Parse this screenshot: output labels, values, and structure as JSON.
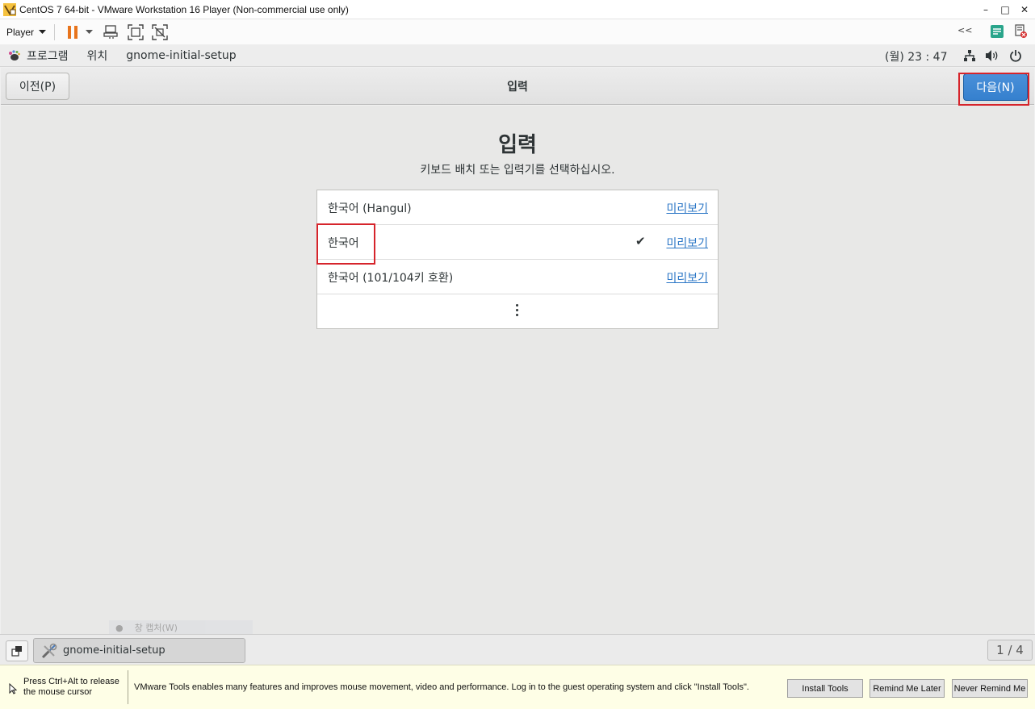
{
  "window": {
    "title": "CentOS 7 64-bit - VMware Workstation 16 Player (Non-commercial use only)",
    "minimize_glyph": "–",
    "maximize_glyph": "□",
    "close_glyph": "✕"
  },
  "vm_toolbar": {
    "player_label": "Player",
    "collapse_glyph": "<<"
  },
  "gnome_panel": {
    "applications": "프로그램",
    "places": "위치",
    "active_app": "gnome-initial-setup",
    "clock": "(월) 23 : 47"
  },
  "header": {
    "prev_label": "이전(P)",
    "title": "입력",
    "next_label": "다음(N)"
  },
  "main": {
    "heading": "입력",
    "subtitle": "키보드 배치 또는 입력기를 선택하십시오.",
    "layouts": [
      {
        "name": "한국어 (Hangul)",
        "selected": false,
        "preview": "미리보기"
      },
      {
        "name": "한국어",
        "selected": true,
        "check": "✔",
        "preview": "미리보기"
      },
      {
        "name": "한국어 (101/104키 호환)",
        "selected": false,
        "preview": "미리보기"
      }
    ],
    "ghost_text": "창 캡처(W)"
  },
  "taskbar": {
    "task_label": "gnome-initial-setup",
    "workspace": "1 / 4"
  },
  "notice": {
    "release_text": "Press Ctrl+Alt to release the mouse cursor",
    "message": "VMware Tools enables many features and improves mouse movement, video and performance. Log in to the guest operating system and click \"Install Tools\".",
    "install_label": "Install Tools",
    "remind_label": "Remind Me Later",
    "never_label": "Never Remind Me"
  },
  "colors": {
    "accent_blue": "#3580ce",
    "highlight_red": "#d6242b",
    "link_blue": "#2a76c6",
    "pause_orange": "#e8741c"
  }
}
